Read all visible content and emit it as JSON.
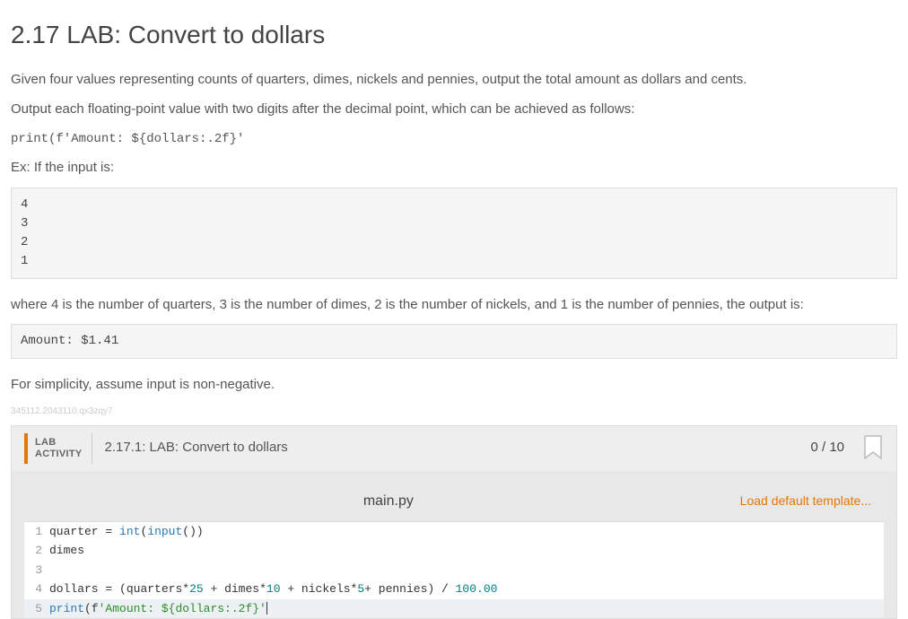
{
  "title": "2.17 LAB: Convert to dollars",
  "intro1": "Given four values representing counts of quarters, dimes, nickels and pennies, output the total amount as dollars and cents.",
  "intro2": "Output each floating-point value with two digits after the decimal point, which can be achieved as follows:",
  "format_example": "print(f'Amount: ${dollars:.2f}'",
  "ex_label": "Ex: If the input is:",
  "input_block": "4\n3\n2\n1",
  "explain": "where 4 is the number of quarters, 3 is the number of dimes, 2 is the number of nickels, and 1 is the number of pennies, the output is:",
  "output_block": "Amount: $1.41",
  "simplicity": "For simplicity, assume input is non-negative.",
  "watermark": "345112.2043110.qx3zqy7",
  "lab": {
    "badge_line1": "LAB",
    "badge_line2": "ACTIVITY",
    "title": "2.17.1: LAB: Convert to dollars",
    "score": "0 / 10",
    "filename": "main.py",
    "load_template": "Load default template..."
  },
  "code_lines": {
    "l1_a": "quarter ",
    "l1_op": "=",
    "l1_b": " ",
    "l1_int": "int",
    "l1_p1": "(",
    "l1_input": "input",
    "l1_p2": "())",
    "l2": "dimes",
    "l3": "",
    "l4_a": "dollars ",
    "l4_eq": "=",
    "l4_b": " (quarters",
    "l4_m1": "*",
    "l4_n25": "25",
    "l4_plus1": " + ",
    "l4_d": "dimes",
    "l4_m2": "*",
    "l4_n10": "10",
    "l4_plus2": " + ",
    "l4_nk": "nickels",
    "l4_m3": "*",
    "l4_n5": "5",
    "l4_plus3": "+ ",
    "l4_p": "pennies) ",
    "l4_div": "/",
    "l4_sp": " ",
    "l4_n100": "100.00",
    "l5_print": "print",
    "l5_p1": "(f",
    "l5_str": "'Amount: ${dollars:.2f}'"
  }
}
